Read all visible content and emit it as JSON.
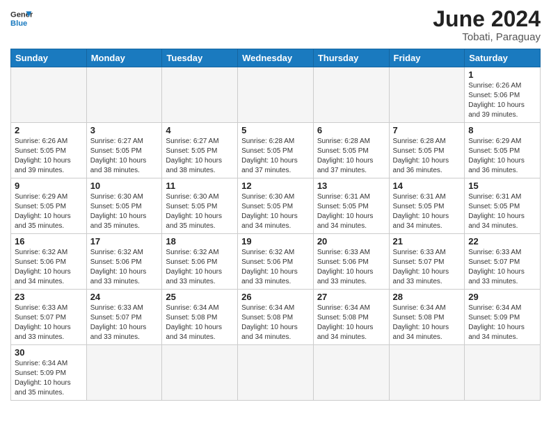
{
  "header": {
    "logo_general": "General",
    "logo_blue": "Blue",
    "month_year": "June 2024",
    "location": "Tobati, Paraguay"
  },
  "days_of_week": [
    "Sunday",
    "Monday",
    "Tuesday",
    "Wednesday",
    "Thursday",
    "Friday",
    "Saturday"
  ],
  "weeks": [
    [
      {
        "day": "",
        "info": ""
      },
      {
        "day": "",
        "info": ""
      },
      {
        "day": "",
        "info": ""
      },
      {
        "day": "",
        "info": ""
      },
      {
        "day": "",
        "info": ""
      },
      {
        "day": "",
        "info": ""
      },
      {
        "day": "1",
        "info": "Sunrise: 6:26 AM\nSunset: 5:06 PM\nDaylight: 10 hours\nand 39 minutes."
      }
    ],
    [
      {
        "day": "2",
        "info": "Sunrise: 6:26 AM\nSunset: 5:05 PM\nDaylight: 10 hours\nand 39 minutes."
      },
      {
        "day": "3",
        "info": "Sunrise: 6:27 AM\nSunset: 5:05 PM\nDaylight: 10 hours\nand 38 minutes."
      },
      {
        "day": "4",
        "info": "Sunrise: 6:27 AM\nSunset: 5:05 PM\nDaylight: 10 hours\nand 38 minutes."
      },
      {
        "day": "5",
        "info": "Sunrise: 6:28 AM\nSunset: 5:05 PM\nDaylight: 10 hours\nand 37 minutes."
      },
      {
        "day": "6",
        "info": "Sunrise: 6:28 AM\nSunset: 5:05 PM\nDaylight: 10 hours\nand 37 minutes."
      },
      {
        "day": "7",
        "info": "Sunrise: 6:28 AM\nSunset: 5:05 PM\nDaylight: 10 hours\nand 36 minutes."
      },
      {
        "day": "8",
        "info": "Sunrise: 6:29 AM\nSunset: 5:05 PM\nDaylight: 10 hours\nand 36 minutes."
      }
    ],
    [
      {
        "day": "9",
        "info": "Sunrise: 6:29 AM\nSunset: 5:05 PM\nDaylight: 10 hours\nand 35 minutes."
      },
      {
        "day": "10",
        "info": "Sunrise: 6:30 AM\nSunset: 5:05 PM\nDaylight: 10 hours\nand 35 minutes."
      },
      {
        "day": "11",
        "info": "Sunrise: 6:30 AM\nSunset: 5:05 PM\nDaylight: 10 hours\nand 35 minutes."
      },
      {
        "day": "12",
        "info": "Sunrise: 6:30 AM\nSunset: 5:05 PM\nDaylight: 10 hours\nand 34 minutes."
      },
      {
        "day": "13",
        "info": "Sunrise: 6:31 AM\nSunset: 5:05 PM\nDaylight: 10 hours\nand 34 minutes."
      },
      {
        "day": "14",
        "info": "Sunrise: 6:31 AM\nSunset: 5:05 PM\nDaylight: 10 hours\nand 34 minutes."
      },
      {
        "day": "15",
        "info": "Sunrise: 6:31 AM\nSunset: 5:05 PM\nDaylight: 10 hours\nand 34 minutes."
      }
    ],
    [
      {
        "day": "16",
        "info": "Sunrise: 6:32 AM\nSunset: 5:06 PM\nDaylight: 10 hours\nand 34 minutes."
      },
      {
        "day": "17",
        "info": "Sunrise: 6:32 AM\nSunset: 5:06 PM\nDaylight: 10 hours\nand 33 minutes."
      },
      {
        "day": "18",
        "info": "Sunrise: 6:32 AM\nSunset: 5:06 PM\nDaylight: 10 hours\nand 33 minutes."
      },
      {
        "day": "19",
        "info": "Sunrise: 6:32 AM\nSunset: 5:06 PM\nDaylight: 10 hours\nand 33 minutes."
      },
      {
        "day": "20",
        "info": "Sunrise: 6:33 AM\nSunset: 5:06 PM\nDaylight: 10 hours\nand 33 minutes."
      },
      {
        "day": "21",
        "info": "Sunrise: 6:33 AM\nSunset: 5:07 PM\nDaylight: 10 hours\nand 33 minutes."
      },
      {
        "day": "22",
        "info": "Sunrise: 6:33 AM\nSunset: 5:07 PM\nDaylight: 10 hours\nand 33 minutes."
      }
    ],
    [
      {
        "day": "23",
        "info": "Sunrise: 6:33 AM\nSunset: 5:07 PM\nDaylight: 10 hours\nand 33 minutes."
      },
      {
        "day": "24",
        "info": "Sunrise: 6:33 AM\nSunset: 5:07 PM\nDaylight: 10 hours\nand 33 minutes."
      },
      {
        "day": "25",
        "info": "Sunrise: 6:34 AM\nSunset: 5:08 PM\nDaylight: 10 hours\nand 34 minutes."
      },
      {
        "day": "26",
        "info": "Sunrise: 6:34 AM\nSunset: 5:08 PM\nDaylight: 10 hours\nand 34 minutes."
      },
      {
        "day": "27",
        "info": "Sunrise: 6:34 AM\nSunset: 5:08 PM\nDaylight: 10 hours\nand 34 minutes."
      },
      {
        "day": "28",
        "info": "Sunrise: 6:34 AM\nSunset: 5:08 PM\nDaylight: 10 hours\nand 34 minutes."
      },
      {
        "day": "29",
        "info": "Sunrise: 6:34 AM\nSunset: 5:09 PM\nDaylight: 10 hours\nand 34 minutes."
      }
    ],
    [
      {
        "day": "30",
        "info": "Sunrise: 6:34 AM\nSunset: 5:09 PM\nDaylight: 10 hours\nand 35 minutes."
      },
      {
        "day": "",
        "info": ""
      },
      {
        "day": "",
        "info": ""
      },
      {
        "day": "",
        "info": ""
      },
      {
        "day": "",
        "info": ""
      },
      {
        "day": "",
        "info": ""
      },
      {
        "day": "",
        "info": ""
      }
    ]
  ]
}
